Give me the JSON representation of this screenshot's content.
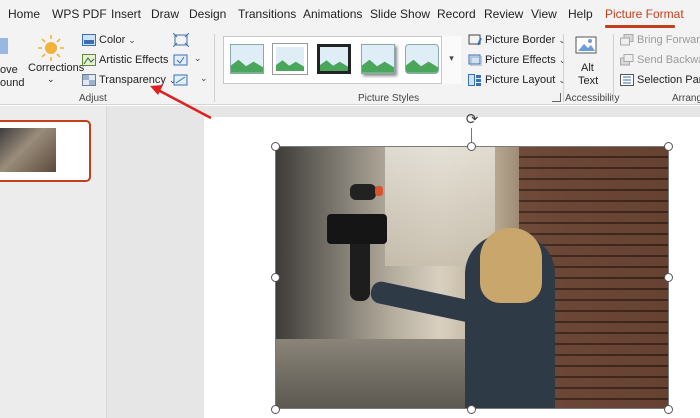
{
  "tabs": [
    {
      "label": "Home",
      "name": "tab-home"
    },
    {
      "label": "WPS PDF",
      "name": "tab-wps-pdf"
    },
    {
      "label": "Insert",
      "name": "tab-insert"
    },
    {
      "label": "Draw",
      "name": "tab-draw"
    },
    {
      "label": "Design",
      "name": "tab-design"
    },
    {
      "label": "Transitions",
      "name": "tab-transitions"
    },
    {
      "label": "Animations",
      "name": "tab-animations"
    },
    {
      "label": "Slide Show",
      "name": "tab-slide-show"
    },
    {
      "label": "Record",
      "name": "tab-record"
    },
    {
      "label": "Review",
      "name": "tab-review"
    },
    {
      "label": "View",
      "name": "tab-view"
    },
    {
      "label": "Help",
      "name": "tab-help"
    },
    {
      "label": "Picture Format",
      "name": "tab-picture-format",
      "active": true
    }
  ],
  "ribbon": {
    "remove_bg_line1": "ove",
    "remove_bg_line2": "ound",
    "corrections": "Corrections",
    "color": "Color",
    "artistic_effects": "Artistic Effects",
    "transparency": "Transparency",
    "adjust_group": "Adjust",
    "picture_styles_group": "Picture Styles",
    "picture_border": "Picture Border",
    "picture_effects": "Picture Effects",
    "picture_layout": "Picture Layout",
    "alt_text_line1": "Alt",
    "alt_text_line2": "Text",
    "accessibility_group": "Accessibility",
    "bring_forward": "Bring Forward",
    "send_backward": "Send Backward",
    "selection_pane": "Selection Pane",
    "arrange_group": "Arrange"
  },
  "colors": {
    "accent": "#c43e1c",
    "annotation_arrow": "#e02020"
  },
  "icons": {
    "corrections": "sun-icon",
    "rotate": "rotate-icon"
  }
}
